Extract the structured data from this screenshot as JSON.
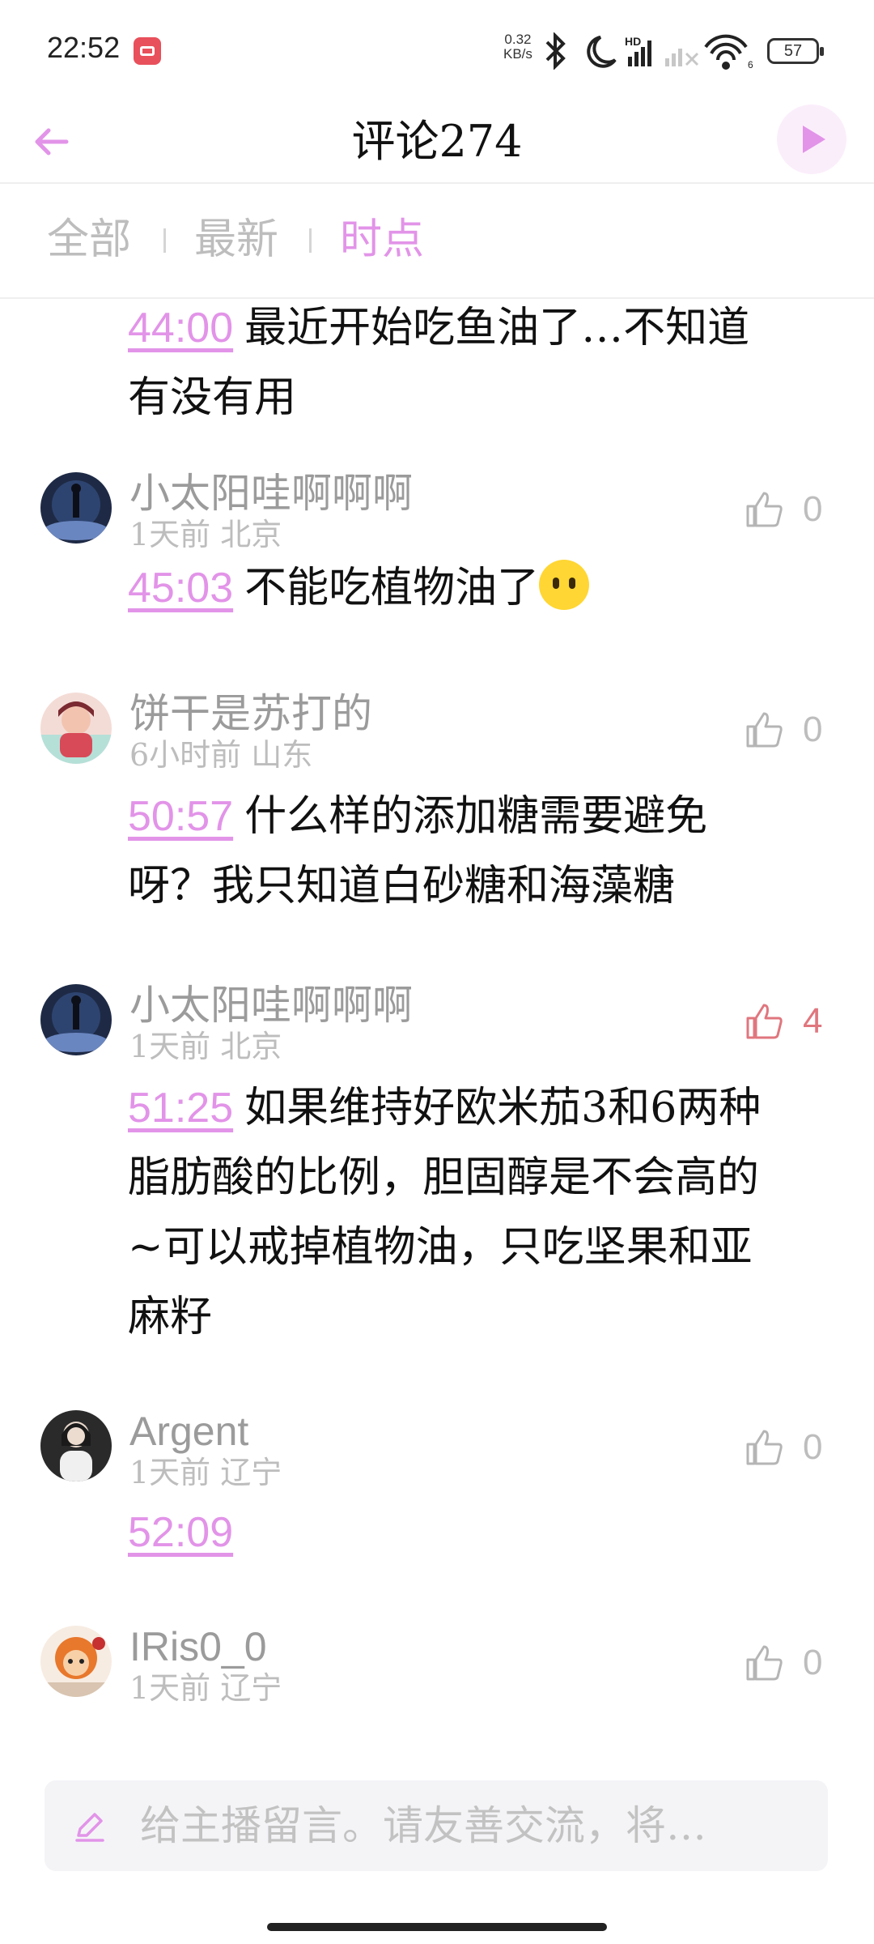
{
  "status": {
    "time": "22:52",
    "net_speed_value": "0.32",
    "net_speed_unit": "KB/s",
    "signal_label": "HD",
    "wifi_label": "6",
    "battery": "57"
  },
  "header": {
    "title": "评论274",
    "accent_color": "#e294e8"
  },
  "tabs": [
    {
      "label": "全部",
      "active": false
    },
    {
      "label": "最新",
      "active": false
    },
    {
      "label": "时点",
      "active": true
    }
  ],
  "comments": [
    {
      "timestamp": "44:00",
      "text_line1": "最近开始吃鱼油了…不知道",
      "text_line2": "有没有用"
    },
    {
      "user": "小太阳哇啊啊啊",
      "meta": "1天前 北京",
      "likes": "0",
      "liked": false,
      "timestamp": "45:03",
      "text": "不能吃植物油了",
      "emoji": "neutral-face-emoji"
    },
    {
      "user": "饼干是苏打的",
      "meta": "6小时前 山东",
      "likes": "0",
      "liked": false,
      "timestamp": "50:57",
      "text_line1": "什么样的添加糖需要避免",
      "text_line2": "呀？我只知道白砂糖和海藻糖"
    },
    {
      "user": "小太阳哇啊啊啊",
      "meta": "1天前 北京",
      "likes": "4",
      "liked": true,
      "timestamp": "51:25",
      "text_line1": "如果维持好欧米茄3和6两种",
      "text_line2": "脂肪酸的比例，胆固醇是不会高的",
      "text_line3": "~可以戒掉植物油，只吃坚果和亚",
      "text_line4": "麻籽"
    },
    {
      "user": "Argent",
      "meta": "1天前 辽宁",
      "likes": "0",
      "liked": false,
      "timestamp": "52:09"
    },
    {
      "user": "IRis0_0",
      "meta": "1天前 辽宁",
      "likes": "0",
      "liked": false
    }
  ],
  "input": {
    "placeholder": "给主播留言。请友善交流，将…"
  }
}
